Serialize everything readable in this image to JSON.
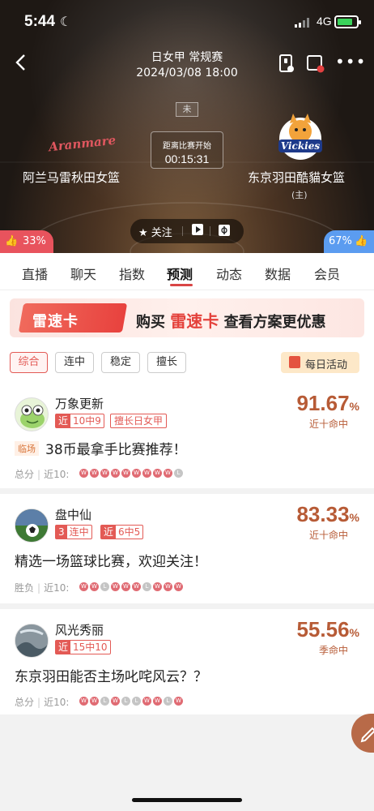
{
  "status_bar": {
    "time": "5:44",
    "network": "4G"
  },
  "header": {
    "league": "日女甲 常规赛",
    "datetime": "2024/03/08 18:00",
    "status": "未",
    "countdown_label": "距离比赛开始",
    "countdown": "00:15:31",
    "home_team": "阿兰马雷秋田女篮",
    "home_logo_text": "Aranmare",
    "away_team": "东京羽田酷貓女篮",
    "away_tag": "(主)",
    "away_logo_text": "Vickies",
    "follow_label": "关注",
    "vote_home": "33%",
    "vote_away": "67%"
  },
  "tabs": [
    "直播",
    "聊天",
    "指数",
    "预测",
    "动态",
    "数据",
    "会员"
  ],
  "active_tab": "预测",
  "banner": {
    "card_text": "雷速卡",
    "text_before": "购买",
    "highlight": "雷速卡",
    "text_after": "查看方案更优惠"
  },
  "filters": [
    "综合",
    "连中",
    "稳定",
    "擅长"
  ],
  "active_filter": "综合",
  "daily_activity": "每日活动",
  "predictions": [
    {
      "name": "万象更新",
      "badges": [
        {
          "tag": "近",
          "text": "10中9"
        },
        {
          "tag": "",
          "text": "擅长日女甲"
        }
      ],
      "rate": "91.67",
      "pct": "%",
      "rate_label": "近十命中",
      "post_tag": "临场",
      "title": "38币最拿手比赛推荐！",
      "record_label": "总分",
      "record_recent": "近10:",
      "results": [
        "W",
        "W",
        "W",
        "W",
        "W",
        "W",
        "W",
        "W",
        "W",
        "L"
      ]
    },
    {
      "name": "盘中仙",
      "badges": [
        {
          "tag": "3",
          "text": "连中"
        },
        {
          "tag": "近",
          "text": "6中5"
        }
      ],
      "rate": "83.33",
      "pct": "%",
      "rate_label": "近十命中",
      "post_tag": "",
      "title": "精选一场篮球比赛，欢迎关注！",
      "record_label": "胜负",
      "record_recent": "近10:",
      "results": [
        "W",
        "W",
        "L",
        "W",
        "W",
        "W",
        "L",
        "W",
        "W",
        "W"
      ]
    },
    {
      "name": "风光秀丽",
      "badges": [
        {
          "tag": "近",
          "text": "15中10"
        }
      ],
      "rate": "55.56",
      "pct": "%",
      "rate_label": "季命中",
      "post_tag": "",
      "title": "东京羽田能否主场叱咤风云？？",
      "record_label": "总分",
      "record_recent": "近10:",
      "results": [
        "W",
        "W",
        "L",
        "W",
        "L",
        "L",
        "W",
        "W",
        "L",
        "W"
      ]
    }
  ],
  "colors": {
    "accent": "#e35a55",
    "rate": "#b75b36",
    "win": "#e06b73",
    "loss": "#c5c5c5",
    "vote_home": "#e8535d",
    "vote_away": "#5b9cf0"
  }
}
